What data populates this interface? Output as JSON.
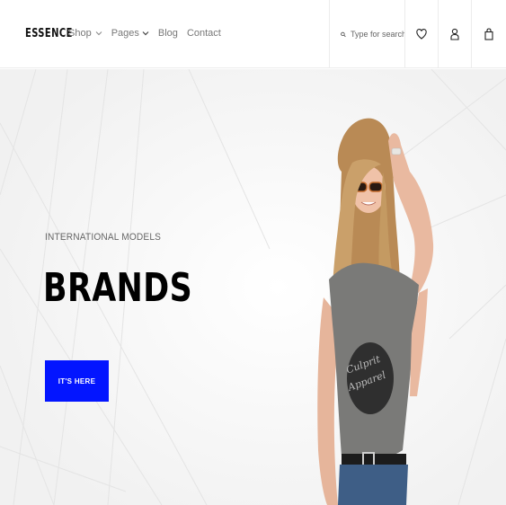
{
  "header": {
    "logo": "ESSENCE",
    "nav": [
      {
        "label": "Shop",
        "has_dropdown": true
      },
      {
        "label": "Pages",
        "has_dropdown": true
      },
      {
        "label": "Blog",
        "has_dropdown": false
      },
      {
        "label": "Contact",
        "has_dropdown": false
      }
    ],
    "search": {
      "placeholder": "Type for search",
      "icon": "search-icon"
    },
    "icons": [
      "heart-icon",
      "user-icon",
      "bag-icon"
    ]
  },
  "hero": {
    "subtitle": "INTERNATIONAL MODELS",
    "title": "BRANDS",
    "button_label": "IT'S HERE",
    "image": "model-woman-sunglasses-gray-tshirt"
  },
  "colors": {
    "accent": "#0315ff",
    "text_dark": "#000000",
    "nav_text": "#777777",
    "hero_bg": "#f7f7f7"
  }
}
